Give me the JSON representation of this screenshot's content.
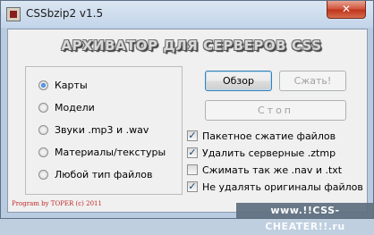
{
  "window": {
    "title": "CSSbzip2 v1.5",
    "close_label": "✕"
  },
  "banner": "АРХИВАТОР ДЛЯ СЕРВЕРОВ CSS",
  "file_types": {
    "selected": "Карты",
    "options": [
      "Карты",
      "Модели",
      "Звуки .mp3 и .wav",
      "Материалы/текстуры",
      "Любой тип файлов"
    ]
  },
  "buttons": {
    "browse": "Обзор",
    "compress": "Сжать!",
    "stop": "Стоп"
  },
  "options": [
    {
      "label": "Пакетное сжатие файлов",
      "checked": true
    },
    {
      "label": "Удалить серверные .ztmp",
      "checked": true
    },
    {
      "label": "Сжимать так же .nav и .txt",
      "checked": false
    },
    {
      "label": "Не удалять оригиналы файлов",
      "checked": true
    }
  ],
  "footer": "Program by TOPER (c) 2011",
  "watermark": "www.!!CSS-CHEATER!!.ru"
}
